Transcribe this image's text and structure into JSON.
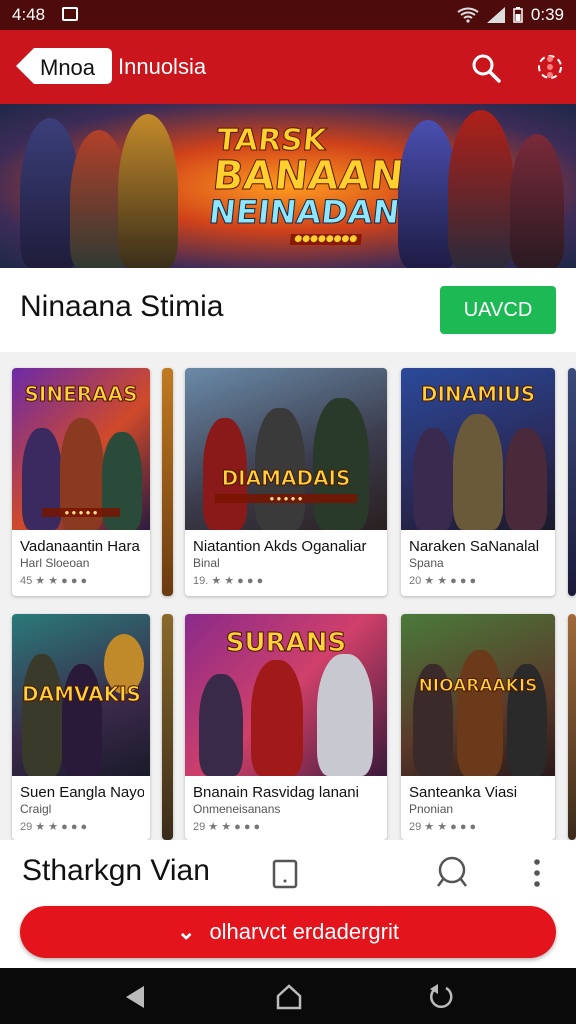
{
  "status_bar": {
    "time": "4:48",
    "right_time": "0:39",
    "icons": [
      "notification-icon",
      "wifi-icon",
      "signal-icon",
      "battery-icon"
    ]
  },
  "app_bar": {
    "back_label": "Mnoa",
    "title": "Innuolsia",
    "icons": [
      "search-icon",
      "more-icon"
    ]
  },
  "banner": {
    "line1": "TARSK",
    "line2": "BANAAN",
    "line3": "NEINADAN",
    "sub": "●●●●●●●●"
  },
  "section": {
    "title": "Ninaana Stimia",
    "button_label": "UAVCD"
  },
  "cards": [
    {
      "thumb_title": "SINERAAS",
      "name": "Vadanaantin Hara",
      "developer": "Harl Sloeoan",
      "rating": "45 ★ ★ ● ● ●"
    },
    {
      "thumb_title": "DIAMADAIS",
      "name": "Niatantion Akds Oganaliar",
      "developer": "Binal",
      "rating": "19. ★ ★ ● ● ●"
    },
    {
      "thumb_title": "DINAMIUS",
      "name": "Naraken SaNanalal",
      "developer": "Spana",
      "rating": "20 ★ ★ ● ● ●"
    },
    {
      "thumb_title": "DAMVAKIS",
      "name": "Suen Eangla Nayoal",
      "developer": "Craigl",
      "rating": "29 ★ ★ ● ● ●"
    },
    {
      "thumb_title": "SURANS",
      "name": "Bnanain Rasvidag lanani",
      "developer": "Onmeneisanans",
      "rating": "29 ★ ★ ● ● ●"
    },
    {
      "thumb_title": "NIOARAAKIS",
      "name": "Santeanka Viasi",
      "developer": "Pnonian",
      "rating": "29 ★ ★ ● ● ●"
    }
  ],
  "bottom_panel": {
    "title": "Stharkgn Vian",
    "cta_label": "olharvct erdadergrit",
    "icons": [
      "tablet-icon",
      "chat-icon",
      "more-vertical-icon"
    ]
  },
  "nav_bar": {
    "icons": [
      "back-icon",
      "home-icon",
      "recents-icon"
    ]
  },
  "colors": {
    "app_bar": "#c9151b",
    "status_bar": "#4e0b0b",
    "accent_green": "#1db954",
    "cta_red": "#e3141b"
  }
}
